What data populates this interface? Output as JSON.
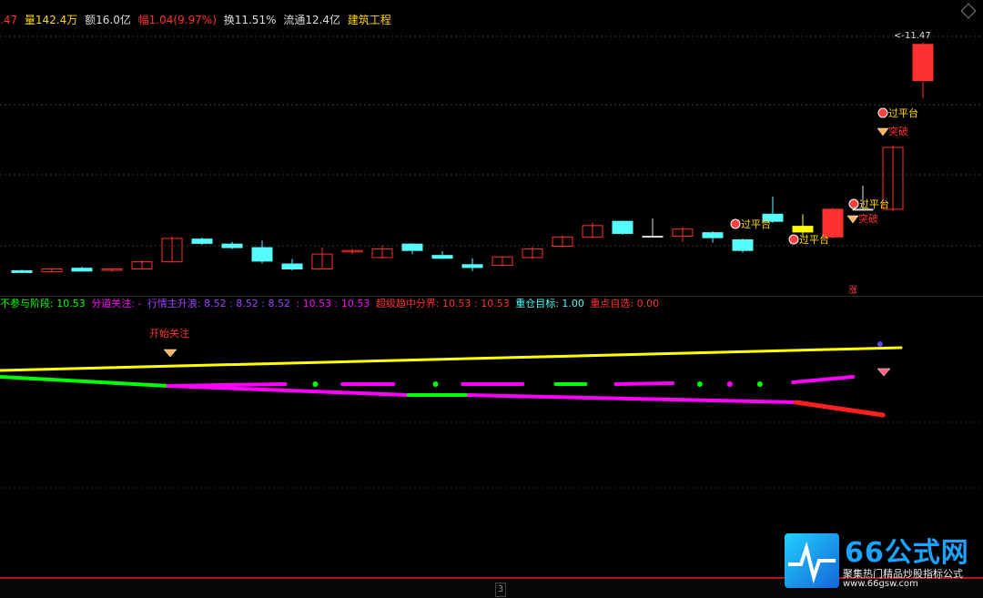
{
  "header": {
    "price_tail": ".47",
    "volume": "量142.4万",
    "amount": "额16.0亿",
    "change": "幅1.04(9.97%)",
    "turnover": "换11.51%",
    "float_cap": "流通12.4亿",
    "sector": "建筑工程"
  },
  "indicator_header": {
    "item1": "不参与阶段: 10.53",
    "item2": "分道关注: -",
    "item3": "行情主升浪: 8.52 : 8.52 : 8.52",
    "item4": ": 10.53 : 10.53",
    "item5": "超级趋中分界: 10.53 : 10.53",
    "item6": "重仓目标: 1.00",
    "item7": "重点自选: 0.00"
  },
  "colors": {
    "up": "#ff3030",
    "down": "#54fcfc",
    "yellow": "#ffff00",
    "magenta": "#ff00ff",
    "green": "#00ff00"
  },
  "chart_data": [
    {
      "type": "candlestick",
      "title": "",
      "price_label": "11.47",
      "ylim": [
        4.6,
        11.9
      ],
      "candles": [
        {
          "o": 5.05,
          "h": 5.08,
          "l": 4.98,
          "c": 5.0
        },
        {
          "o": 5.02,
          "h": 5.12,
          "l": 5.0,
          "c": 5.1
        },
        {
          "o": 5.12,
          "h": 5.16,
          "l": 5.02,
          "c": 5.04
        },
        {
          "o": 5.06,
          "h": 5.12,
          "l": 5.02,
          "c": 5.1
        },
        {
          "o": 5.1,
          "h": 5.34,
          "l": 5.08,
          "c": 5.3
        },
        {
          "o": 5.3,
          "h": 6.02,
          "l": 5.28,
          "c": 5.96
        },
        {
          "o": 5.94,
          "h": 5.98,
          "l": 5.78,
          "c": 5.82
        },
        {
          "o": 5.8,
          "h": 5.86,
          "l": 5.66,
          "c": 5.7
        },
        {
          "o": 5.7,
          "h": 5.9,
          "l": 5.26,
          "c": 5.32
        },
        {
          "o": 5.24,
          "h": 5.38,
          "l": 5.06,
          "c": 5.1
        },
        {
          "o": 5.1,
          "h": 5.7,
          "l": 5.08,
          "c": 5.52
        },
        {
          "o": 5.58,
          "h": 5.66,
          "l": 5.52,
          "c": 5.62
        },
        {
          "o": 5.42,
          "h": 5.76,
          "l": 5.4,
          "c": 5.66
        },
        {
          "o": 5.8,
          "h": 5.82,
          "l": 5.52,
          "c": 5.62
        },
        {
          "o": 5.48,
          "h": 5.6,
          "l": 5.38,
          "c": 5.4
        },
        {
          "o": 5.22,
          "h": 5.4,
          "l": 5.04,
          "c": 5.14
        },
        {
          "o": 5.2,
          "h": 5.46,
          "l": 5.18,
          "c": 5.44
        },
        {
          "o": 5.42,
          "h": 5.72,
          "l": 5.38,
          "c": 5.66
        },
        {
          "o": 5.74,
          "h": 6.04,
          "l": 5.7,
          "c": 6.0
        },
        {
          "o": 6.0,
          "h": 6.4,
          "l": 5.96,
          "c": 6.32
        },
        {
          "o": 6.44,
          "h": 6.46,
          "l": 6.06,
          "c": 6.1
        },
        {
          "o": 6.02,
          "h": 6.52,
          "l": 6.0,
          "c": 6.02
        },
        {
          "o": 6.02,
          "h": 6.28,
          "l": 5.86,
          "c": 6.22
        },
        {
          "o": 6.12,
          "h": 6.16,
          "l": 5.84,
          "c": 5.98
        },
        {
          "o": 5.92,
          "h": 5.96,
          "l": 5.56,
          "c": 5.62
        },
        {
          "o": 6.64,
          "h": 7.14,
          "l": 6.4,
          "c": 6.44
        },
        {
          "o": 6.14,
          "h": 6.64,
          "l": 5.98,
          "c": 6.3
        },
        {
          "o": 6.0,
          "h": 6.82,
          "l": 5.96,
          "c": 6.78
        },
        {
          "o": 6.76,
          "h": 7.44,
          "l": 6.74,
          "c": 6.78
        },
        {
          "o": 6.78,
          "h": 8.58,
          "l": 6.72,
          "c": 8.52
        },
        {
          "o": 10.4,
          "h": 11.47,
          "l": 9.9,
          "c": 11.42
        }
      ]
    },
    {
      "type": "line",
      "title": "",
      "ylim": [
        0,
        1
      ],
      "series": [
        {
          "color": "#ffff00",
          "segments": [
            {
              "x": [
                0,
                30
              ],
              "y": [
                0.19,
                0.44
              ]
            }
          ]
        },
        {
          "color": "#00ff00",
          "segments": [
            {
              "x": [
                0,
                5.6
              ],
              "y": [
                0.12,
                0.02
              ]
            }
          ]
        },
        {
          "color": "#ff00ff",
          "segments": [
            {
              "x": [
                5.6,
                13.6
              ],
              "y": [
                0.02,
                -0.08
              ]
            },
            {
              "x": [
                15.5,
                26.5
              ],
              "y": [
                -0.08,
                -0.16
              ]
            }
          ]
        },
        {
          "color": "#00ff00",
          "segments": [
            {
              "x": [
                13.6,
                15.5
              ],
              "y": [
                -0.08,
                -0.08
              ]
            }
          ]
        },
        {
          "color": "#ff2020",
          "segments": [
            {
              "x": [
                26.5,
                29.4
              ],
              "y": [
                -0.16,
                -0.3
              ]
            }
          ]
        },
        {
          "color": "#ff00ff",
          "segments": [
            {
              "x": [
                5.6,
                9.5
              ],
              "y": [
                0.02,
                0.04
              ]
            },
            {
              "x": [
                11.4,
                13.1
              ],
              "y": [
                0.04,
                0.04
              ]
            },
            {
              "x": [
                15.4,
                17.4
              ],
              "y": [
                0.04,
                0.04
              ]
            },
            {
              "x": [
                20.5,
                22.4
              ],
              "y": [
                0.04,
                0.05
              ]
            },
            {
              "x": [
                26.4,
                28.4
              ],
              "y": [
                0.06,
                0.12
              ]
            }
          ]
        },
        {
          "color": "#00ff00",
          "segments": [
            {
              "x": [
                18.5,
                19.5
              ],
              "y": [
                0.04,
                0.04
              ]
            }
          ]
        }
      ],
      "markers": [
        {
          "x": 10.5,
          "y": 0.04,
          "color": "#00ff00"
        },
        {
          "x": 14.5,
          "y": 0.04,
          "color": "#00ff00"
        },
        {
          "x": 23.3,
          "y": 0.04,
          "color": "#00ff00"
        },
        {
          "x": 24.3,
          "y": 0.04,
          "color": "#ff00ff"
        },
        {
          "x": 25.3,
          "y": 0.04,
          "color": "#00ff00"
        },
        {
          "x": 29.3,
          "y": 0.48,
          "color": "#6040ff"
        }
      ]
    }
  ],
  "annotations": {
    "guotaitai": "过平台",
    "tupo": "突破",
    "zhang": "涨",
    "start_focus": "开始关注"
  },
  "bottom": {
    "tab": "3"
  },
  "logo": {
    "title": "66公式网",
    "subtitle": "聚集热门精品炒股指标公式",
    "url": "www.66gsw.com"
  }
}
